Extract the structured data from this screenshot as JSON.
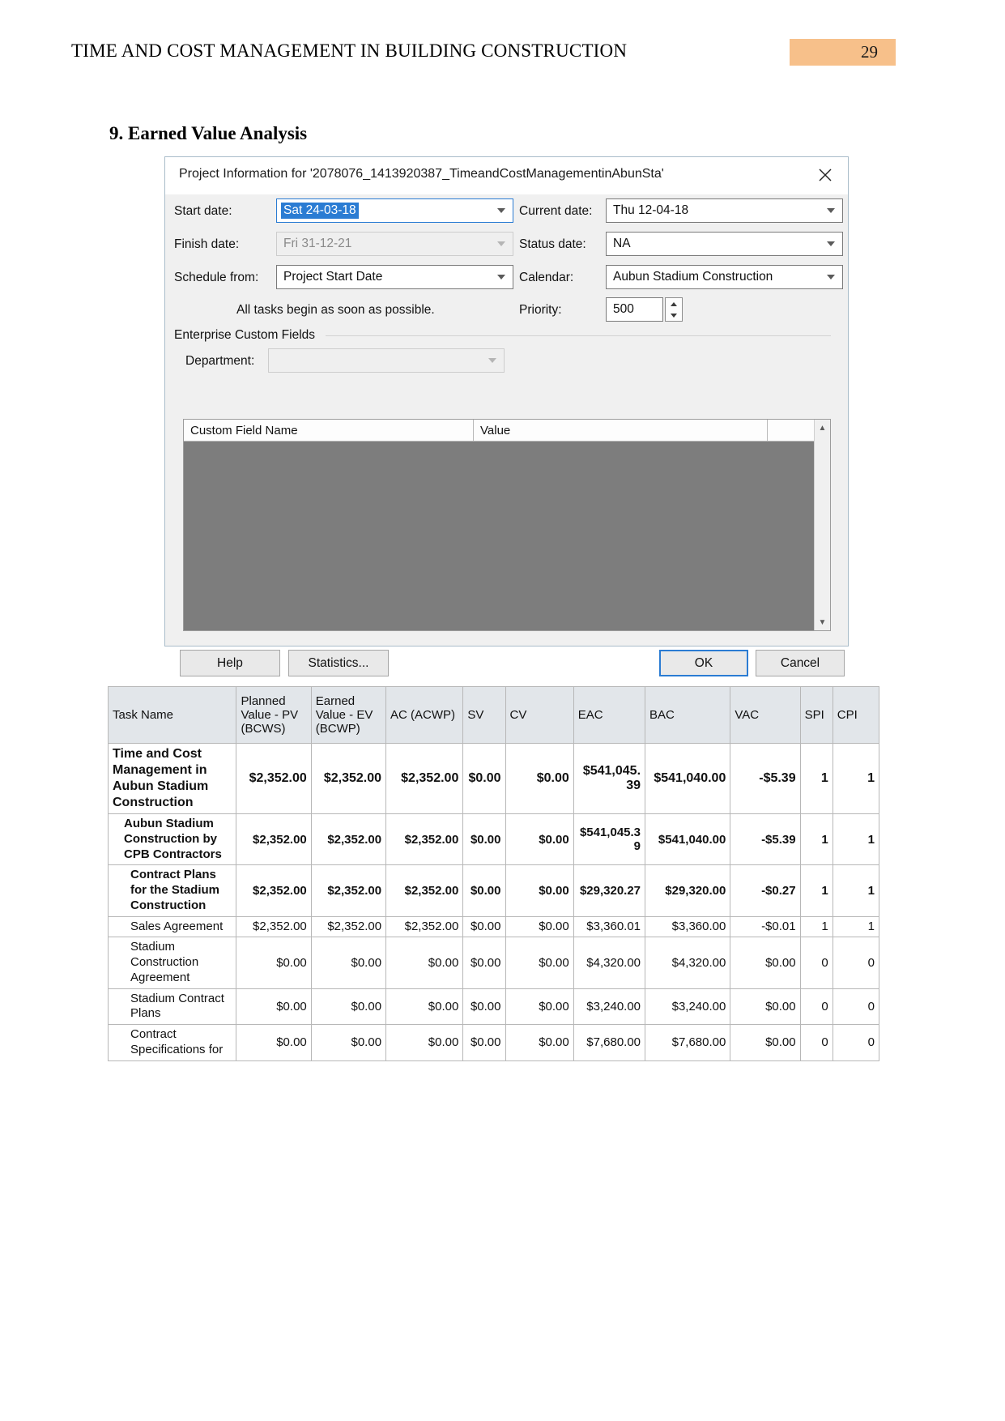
{
  "header": {
    "doc_title": "TIME AND COST MANAGEMENT IN BUILDING CONSTRUCTION",
    "page_number": "29",
    "badge_color": "#f7c08a"
  },
  "section": {
    "heading": "9. Earned Value Analysis"
  },
  "dialog": {
    "title": "Project Information for '2078076_1413920387_TimeandCostManagementinAbunSta'",
    "close_label": "×",
    "labels": {
      "start_date": "Start date:",
      "finish_date": "Finish date:",
      "schedule_from": "Schedule from:",
      "current_date": "Current date:",
      "status_date": "Status date:",
      "calendar": "Calendar:",
      "priority": "Priority:",
      "all_tasks_note": "All tasks begin as soon as possible.",
      "enterprise_custom_fields": "Enterprise Custom Fields",
      "department": "Department:"
    },
    "values": {
      "start_date": "Sat 24-03-18",
      "finish_date": "Fri 31-12-21",
      "schedule_from": "Project Start Date",
      "current_date": "Thu 12-04-18",
      "status_date": "NA",
      "calendar": "Aubun Stadium Construction",
      "priority": "500",
      "department": ""
    },
    "custom_fields_grid": {
      "columns": [
        "Custom Field Name",
        "Value"
      ]
    },
    "buttons": {
      "help": "Help",
      "statistics": "Statistics...",
      "ok": "OK",
      "cancel": "Cancel"
    }
  },
  "ev_table": {
    "columns": [
      "Task Name",
      "Planned Value - PV (BCWS)",
      "Earned Value - EV (BCWP)",
      "AC (ACWP)",
      "SV",
      "CV",
      "EAC",
      "BAC",
      "VAC",
      "SPI",
      "CPI"
    ],
    "rows": [
      {
        "name": "Time and Cost Management in Aubun Stadium Construction",
        "indent": 0,
        "style": "bold",
        "pv": "$2,352.00",
        "ev": "$2,352.00",
        "ac": "$2,352.00",
        "sv": "$0.00",
        "cv": "$0.00",
        "eac": "$541,045.39",
        "bac": "$541,040.00",
        "vac": "-$5.39",
        "spi": "1",
        "cpi": "1"
      },
      {
        "name": "Aubun Stadium Construction by CPB Contractors",
        "indent": 1,
        "style": "semibold",
        "pv": "$2,352.00",
        "ev": "$2,352.00",
        "ac": "$2,352.00",
        "sv": "$0.00",
        "cv": "$0.00",
        "eac": "$541,045.39",
        "bac": "$541,040.00",
        "vac": "-$5.39",
        "spi": "1",
        "cpi": "1"
      },
      {
        "name": "Contract Plans for the Stadium Construction",
        "indent": 2,
        "style": "semibold",
        "pv": "$2,352.00",
        "ev": "$2,352.00",
        "ac": "$2,352.00",
        "sv": "$0.00",
        "cv": "$0.00",
        "eac": "$29,320.27",
        "bac": "$29,320.00",
        "vac": "-$0.27",
        "spi": "1",
        "cpi": "1"
      },
      {
        "name": "Sales Agreement",
        "indent": 2,
        "style": "normal",
        "pv": "$2,352.00",
        "ev": "$2,352.00",
        "ac": "$2,352.00",
        "sv": "$0.00",
        "cv": "$0.00",
        "eac": "$3,360.01",
        "bac": "$3,360.00",
        "vac": "-$0.01",
        "spi": "1",
        "cpi": "1"
      },
      {
        "name": "Stadium Construction Agreement",
        "indent": 2,
        "style": "normal",
        "pv": "$0.00",
        "ev": "$0.00",
        "ac": "$0.00",
        "sv": "$0.00",
        "cv": "$0.00",
        "eac": "$4,320.00",
        "bac": "$4,320.00",
        "vac": "$0.00",
        "spi": "0",
        "cpi": "0"
      },
      {
        "name": "Stadium Contract Plans",
        "indent": 2,
        "style": "normal",
        "pv": "$0.00",
        "ev": "$0.00",
        "ac": "$0.00",
        "sv": "$0.00",
        "cv": "$0.00",
        "eac": "$3,240.00",
        "bac": "$3,240.00",
        "vac": "$0.00",
        "spi": "0",
        "cpi": "0"
      },
      {
        "name": "Contract Specifications for",
        "indent": 2,
        "style": "normal",
        "pv": "$0.00",
        "ev": "$0.00",
        "ac": "$0.00",
        "sv": "$0.00",
        "cv": "$0.00",
        "eac": "$7,680.00",
        "bac": "$7,680.00",
        "vac": "$0.00",
        "spi": "0",
        "cpi": "0"
      }
    ]
  }
}
